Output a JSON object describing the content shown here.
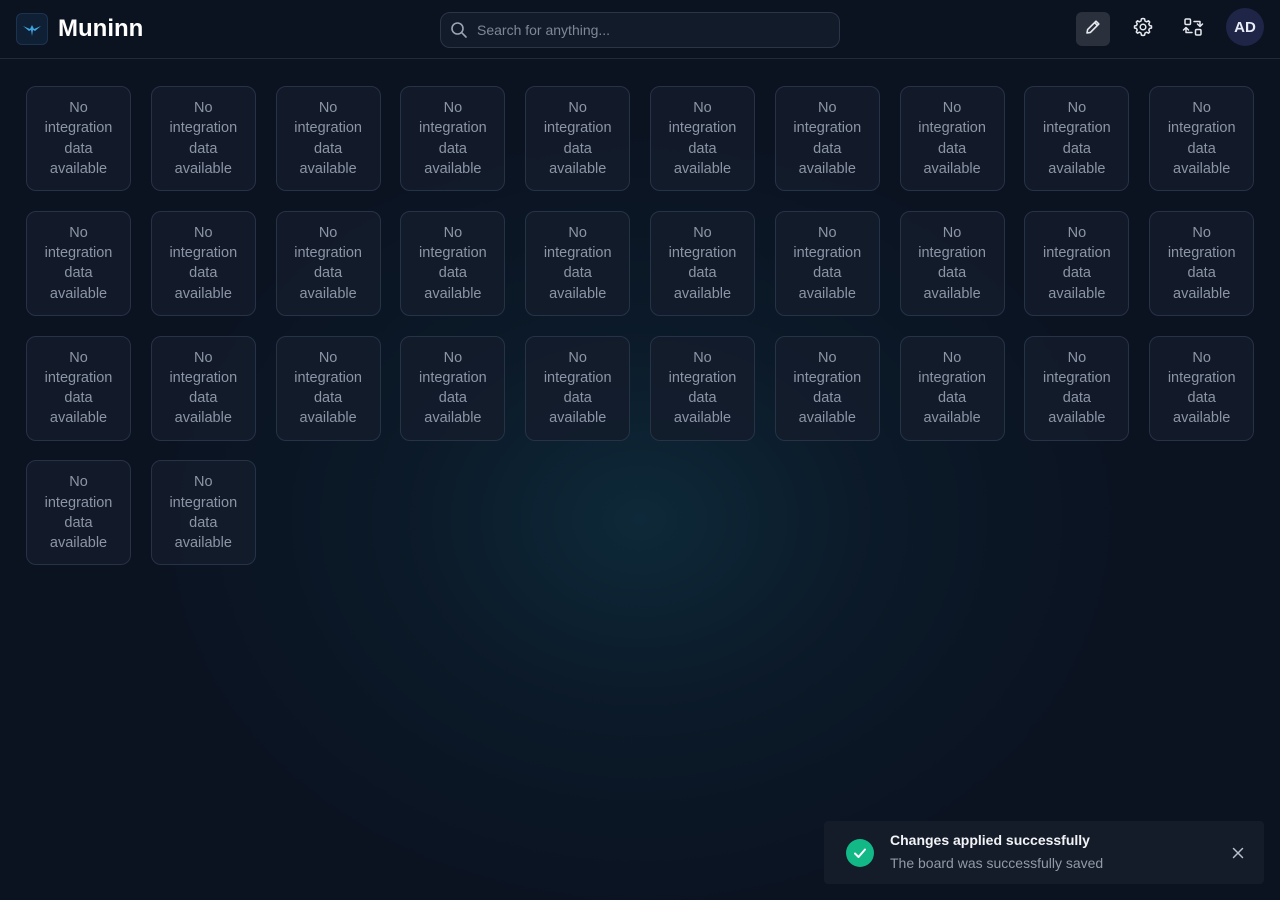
{
  "app": {
    "name": "Muninn",
    "logo_icon": "raven-logo-icon"
  },
  "header": {
    "search_placeholder": "Search for anything...",
    "search_icon": "search-icon",
    "buttons": [
      {
        "name": "edit-mode-button",
        "icon": "pencil-icon",
        "active": true
      },
      {
        "name": "settings-button",
        "icon": "gear-icon",
        "active": false
      },
      {
        "name": "switch-board-button",
        "icon": "arrows-exchange-icon",
        "active": false
      }
    ],
    "avatar_initials": "AD"
  },
  "board": {
    "tile_text": "No integration data available",
    "tile_count": 32
  },
  "toast": {
    "title": "Changes applied successfully",
    "message": "The board was successfully saved",
    "status": "success",
    "status_color": "#12b886"
  },
  "colors": {
    "background": "#0b1220",
    "tile_background": "#141c2c",
    "accent_success": "#12b886"
  }
}
